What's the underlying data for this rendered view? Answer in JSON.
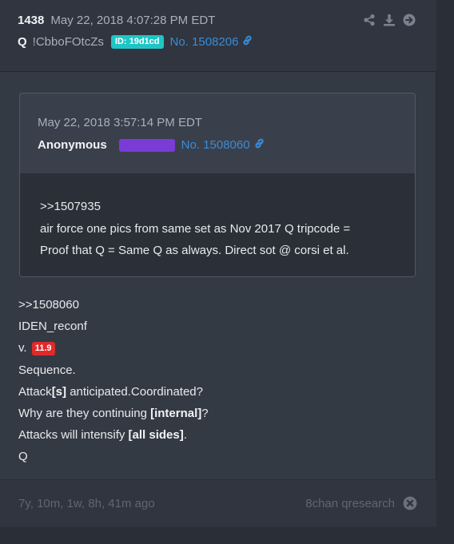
{
  "header": {
    "post_number": "1438",
    "date": "May 22, 2018 4:07:28 PM EDT",
    "name": "Q",
    "tripcode": "!CbboFOtcZs",
    "id_badge": "ID: 19d1cd",
    "post_link": "No. 1508206",
    "action_icons": [
      "share-icon",
      "download-icon",
      "arrow-circle-right-icon"
    ]
  },
  "quote": {
    "date": "May 22, 2018 3:57:14 PM EDT",
    "name": "Anonymous",
    "post_link": "No. 1508060",
    "lines": [
      ">>1507935",
      "air force one pics from same set as Nov 2017 Q tripcode =",
      "Proof that Q = Same Q as always. Direct sot @ corsi et al."
    ]
  },
  "body": {
    "line1": ">>1508060",
    "line2": "IDEN_reconf",
    "line3_prefix": "v.",
    "version_badge": "11.9",
    "line4": "Sequence.",
    "line5_a": "Attack",
    "line5_b": "[s]",
    "line5_c": " anticipated.Coordinated?",
    "line6_a": "Why are they continuing ",
    "line6_b": "[internal]",
    "line6_c": "?",
    "line7_a": "Attacks will intensify ",
    "line7_b": "[all sides]",
    "line7_c": ".",
    "line8": "Q"
  },
  "footer": {
    "ago": "7y, 10m, 1w, 8h, 41m ago",
    "source": "8chan qresearch"
  },
  "colors": {
    "id_badge": "#1fc5c5",
    "link": "#3a8bd8",
    "version_badge": "#e02a2a",
    "redacted_badge": "#7a3bd6"
  }
}
